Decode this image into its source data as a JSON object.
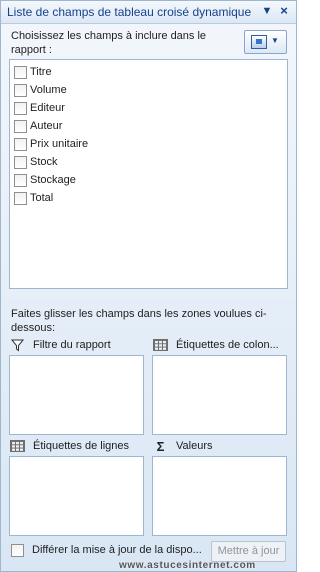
{
  "titlebar": {
    "title": "Liste de champs de tableau croisé dynamique",
    "dropdown_icon": "chevron-down-icon",
    "close_icon": "close-icon"
  },
  "fields_section": {
    "label": "Choisissez les champs à inclure dans le rapport :",
    "layout_button_icon": "field-layout-icon",
    "items": [
      {
        "label": "Titre",
        "checked": false
      },
      {
        "label": "Volume",
        "checked": false
      },
      {
        "label": "Editeur",
        "checked": false
      },
      {
        "label": "Auteur",
        "checked": false
      },
      {
        "label": "Prix unitaire",
        "checked": false
      },
      {
        "label": "Stock",
        "checked": false
      },
      {
        "label": "Stockage",
        "checked": false
      },
      {
        "label": "Total",
        "checked": false
      }
    ]
  },
  "areas": {
    "instructions": "Faites glisser les champs dans les zones voulues ci-dessous:",
    "report_filter": "Filtre du rapport",
    "column_labels": "Étiquettes de colon...",
    "row_labels": "Étiquettes de lignes",
    "values": "Valeurs"
  },
  "footer": {
    "defer_label": "Différer la mise à jour de la dispo...",
    "defer_checked": false,
    "update_button": "Mettre à jour"
  },
  "watermark": "www.astucesinternet.com",
  "colors": {
    "accent": "#15428b",
    "border": "#9eb6ce",
    "panel_bg": "#dce7f5"
  }
}
